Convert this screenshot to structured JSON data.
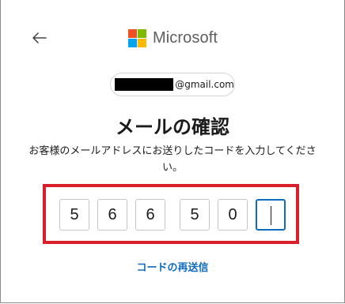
{
  "header": {
    "back_icon": "arrow-left-icon",
    "logo_text": "Microsoft",
    "logo_colors": [
      "#f25022",
      "#7fba00",
      "#00a4ef",
      "#ffb900"
    ]
  },
  "account": {
    "email_suffix": "@gmail.com"
  },
  "main": {
    "title": "メールの確認",
    "description": "お客様のメールアドレスにお送りしたコードを入力してください。"
  },
  "code_inputs": [
    "5",
    "6",
    "6",
    "5",
    "0",
    ""
  ],
  "links": {
    "resend": "コードの再送信"
  },
  "colors": {
    "accent": "#0f6cbd",
    "highlight": "#d91f2c"
  }
}
